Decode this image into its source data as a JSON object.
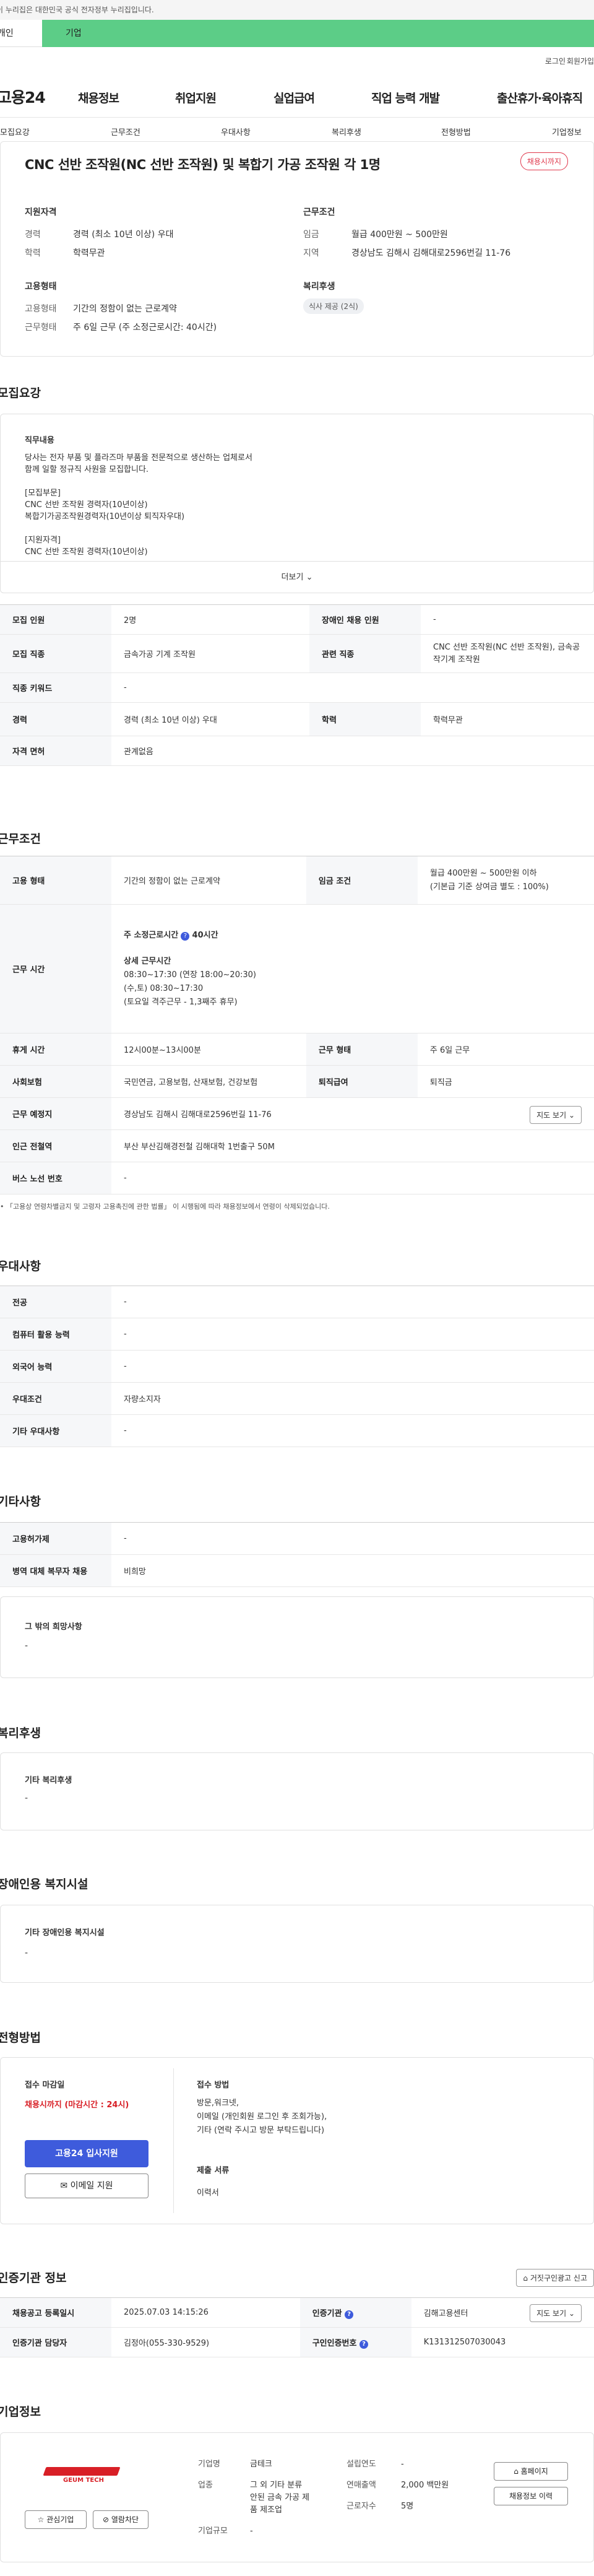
{
  "top": {
    "gov_notice": "이 누리집은 대한민국 공식 전자정부 누리집입니다.",
    "tab_personal": "개인",
    "tab_company": "기업",
    "login": "로그인",
    "signup": "회원가입"
  },
  "gnb": {
    "logo": "고용24",
    "items": [
      "채용정보",
      "취업지원",
      "실업급여",
      "직업 능력 개발",
      "출산휴가·육아휴직"
    ]
  },
  "subnav": [
    "모집요강",
    "근무조건",
    "우대사항",
    "복리후생",
    "전형방법",
    "기업정보"
  ],
  "header": {
    "title": "CNC 선반 조작원(NC 선반 조작원) 및 복합기 가공 조작원 각 1명",
    "badge": "채용시까지",
    "qual_h": "지원자격",
    "exp_k": "경력",
    "exp_v": "경력 (최소 10년 이상) 우대",
    "edu_k": "학력",
    "edu_v": "학력무관",
    "cond_h": "근무조건",
    "wage_k": "임금",
    "wage_v": "월급 400만원 ~ 500만원",
    "region_k": "지역",
    "region_v": "경상남도 김해시 김해대로2596번길 11-76",
    "emp_h": "고용형태",
    "emptype_k": "고용형태",
    "emptype_v": "기간의 정함이 없는 근로계약",
    "workform_k": "근무형태",
    "workform_v": "주 6일 근무 (주 소정근로시간: 40시간)",
    "welfare_h": "복리후생",
    "welfare_chip": "식사 제공 (2식)"
  },
  "recruit": {
    "heading": "모집요강",
    "duty_h": "직무내용",
    "lines": [
      "당사는 전자 부품 및 플라즈마 부품을 전문적으로 생산하는 업체로서",
      "함께 일할 정규직 사원을 모집합니다.",
      "",
      "[모집부문]",
      "CNC 선반 조작원 경력자(10년이상)",
      "복합기가공조작원경력자(10년이상 퇴직자우대)",
      "",
      "[지원자격]",
      "CNC 선반 조작원 경력자(10년이상)"
    ],
    "more": "더보기",
    "rows": [
      [
        "모집 인원",
        "2명",
        "장애인 채용 인원",
        "-"
      ],
      [
        "모집 직종",
        "금속가공 기계 조작원",
        "관련 직종",
        "CNC 선반 조작원(NC 선반 조작원), 금속공작기계 조작원"
      ],
      [
        "직종 키워드",
        "-"
      ],
      [
        "경력",
        "경력 (최소 10년 이상) 우대",
        "학력",
        "학력무관"
      ],
      [
        "자격 면허",
        "관계없음"
      ]
    ]
  },
  "work": {
    "heading": "근무조건",
    "emp_k": "고용 형태",
    "emp_v": "기간의 정함이 없는 근로계약",
    "wage_k": "임금 조건",
    "wage_v1": "월급 400만원 ~ 500만원 이하",
    "wage_v2": "(기본급 기준 상여금 별도 : 100%)",
    "time_k": "근무 시간",
    "weekly": "주 소정근로시간",
    "weekly_v": "40시간",
    "detail_h": "상세 근무시간",
    "detail": [
      "08:30~17:30 (연장 18:00~20:30)",
      "(수,토) 08:30~17:30",
      "(토요일 격주근무 - 1,3째주 휴무)"
    ],
    "rest_k": "휴게 시간",
    "rest_v": "12시00분~13시00분",
    "form_k": "근무 형태",
    "form_v": "주 6일 근무",
    "ins_k": "사회보험",
    "ins_v": "국민연금, 고용보험, 산재보험, 건강보험",
    "ret_k": "퇴직급여",
    "ret_v": "퇴직금",
    "loc_k": "근무 예정지",
    "loc_v": "경상남도 김해시 김해대로2596번길 11-76",
    "map_btn": "지도 보기",
    "sub_k": "인근 전철역",
    "sub_v": "부산 부산김해경전철 김해대학 1번출구 50M",
    "bus_k": "버스 노선 번호",
    "bus_v": "-",
    "note": "「고용상 연령차별금지 및 고령자 고용촉진에 관한 법률」 이 시행됨에 따라 채용정보에서 연령이 삭제되었습니다."
  },
  "pref": {
    "heading": "우대사항",
    "rows": [
      [
        "전공",
        "-"
      ],
      [
        "컴퓨터 활용 능력",
        "-"
      ],
      [
        "외국어 능력",
        "-"
      ],
      [
        "우대조건",
        "자량소지자"
      ],
      [
        "기타 우대사항",
        "-"
      ]
    ]
  },
  "etc": {
    "heading": "기타사항",
    "rows": [
      [
        "고용허가제",
        "-"
      ],
      [
        "병역 대체 복무자 채용",
        "비희망"
      ]
    ],
    "other_h": "그 밖의 희망사항",
    "other_v": "-"
  },
  "welfare": {
    "heading": "복리후생",
    "h": "기타 복리후생",
    "v": "-"
  },
  "disab": {
    "heading": "장애인용 복지시설",
    "h": "기타 장애인용 복지시설",
    "v": "-"
  },
  "process": {
    "heading": "전형방법",
    "deadline_h": "접수 마감일",
    "deadline_v": "채용시까지 (마감시간 : 24시)",
    "apply_btn": "고용24 입사지원",
    "email_btn": "이메일 지원",
    "method_h": "접수 방법",
    "method_lines": [
      "방문,워크넷,",
      "이메일 (개인회원 로그인 후 조회가능),",
      "기타 (연락 주시고 방문 부탁드립니다)"
    ],
    "doc_h": "제출 서류",
    "doc_v": "이력서"
  },
  "agency": {
    "heading": "인증기관 정보",
    "report_btn": "거짓구인광고 신고",
    "reg_k": "채용공고 등록일시",
    "reg_v": "2025.07.03 14:15:26",
    "org_k": "인증기관",
    "org_v": "김해고용센터",
    "map_btn": "지도 보기",
    "staff_k": "인증기관 담당자",
    "staff_v": "김정아(055-330-9529)",
    "id_k": "구인인증번호",
    "id_v": "K131312507030043"
  },
  "company": {
    "heading": "기업정보",
    "logo_text": "GEUM TECH",
    "fav": "관심기업",
    "block": "열람차단",
    "name_k": "기업명",
    "name_v": "금테크",
    "ind_k": "업종",
    "ind_v": [
      "그 외 기타 분류",
      "안된 금속 가공 제",
      "품 제조업"
    ],
    "scale_k": "기업규모",
    "scale_v": "-",
    "found_k": "설립연도",
    "found_v": "-",
    "rev_k": "연매출액",
    "rev_v": "2,000 백만원",
    "emp_k": "근로자수",
    "emp_v": "5명",
    "home_btn": "홈페이지",
    "more_btn": "채용정보 이력"
  },
  "colors": {
    "green": "#5ccd87",
    "blue": "#3e5bdc",
    "red": "#d81f26"
  }
}
